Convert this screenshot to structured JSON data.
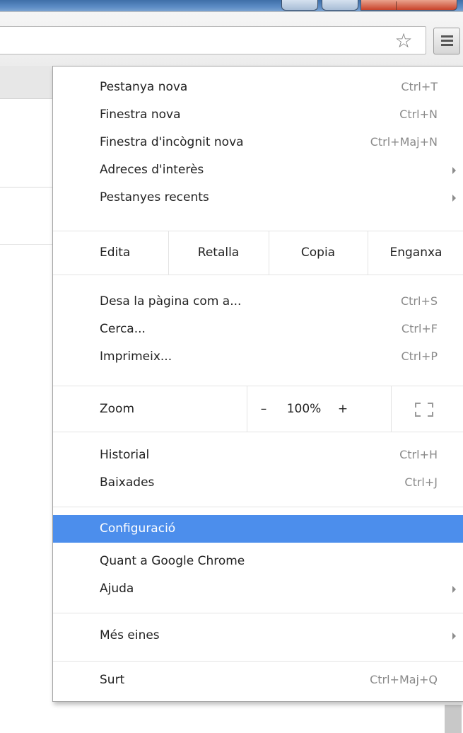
{
  "menu": {
    "group1": [
      {
        "label": "Pestanya nova",
        "shortcut": "Ctrl+T"
      },
      {
        "label": "Finestra nova",
        "shortcut": "Ctrl+N"
      },
      {
        "label": "Finestra d'incògnit nova",
        "shortcut": "Ctrl+Maj+N"
      },
      {
        "label": "Adreces d'interès",
        "shortcut": ""
      },
      {
        "label": "Pestanyes recents",
        "shortcut": ""
      }
    ],
    "edit": {
      "label": "Edita",
      "cut": "Retalla",
      "copy": "Copia",
      "paste": "Enganxa"
    },
    "group2": [
      {
        "label": "Desa la pàgina com a...",
        "shortcut": "Ctrl+S"
      },
      {
        "label": "Cerca...",
        "shortcut": "Ctrl+F"
      },
      {
        "label": "Imprimeix...",
        "shortcut": "Ctrl+P"
      }
    ],
    "zoom": {
      "label": "Zoom",
      "minus": "–",
      "value": "100%",
      "plus": "+"
    },
    "group3": [
      {
        "label": "Historial",
        "shortcut": "Ctrl+H"
      },
      {
        "label": "Baixades",
        "shortcut": "Ctrl+J"
      }
    ],
    "group4": [
      {
        "label": "Configuració",
        "shortcut": ""
      },
      {
        "label": "Quant a Google Chrome",
        "shortcut": ""
      },
      {
        "label": "Ajuda",
        "shortcut": ""
      }
    ],
    "group5": [
      {
        "label": "Més eines",
        "shortcut": ""
      }
    ],
    "group6": [
      {
        "label": "Surt",
        "shortcut": "Ctrl+Maj+Q"
      }
    ]
  },
  "colors": {
    "highlight": "#4c8eec",
    "titlebar": "#5b8bc4",
    "close": "#c8432a"
  },
  "icons": {
    "bookmark": "star-icon",
    "menu": "hamburger-menu-icon",
    "fullscreen": "fullscreen-icon",
    "submenu": "submenu-arrow-icon"
  }
}
